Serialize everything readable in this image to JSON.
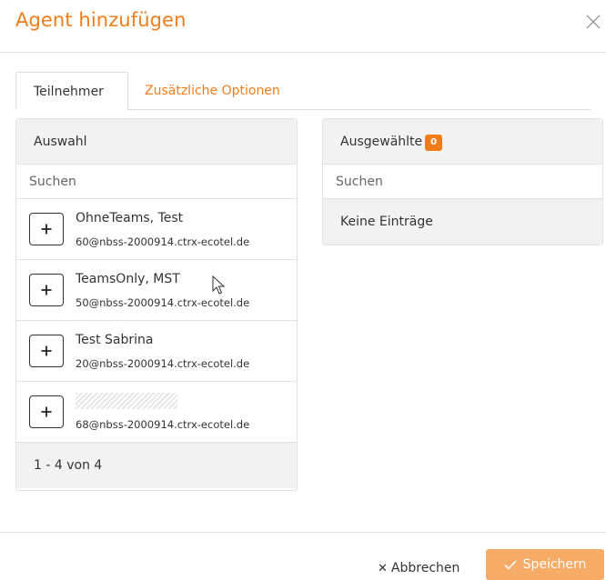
{
  "modal": {
    "title": "Agent hinzufügen",
    "close_icon": "close-icon"
  },
  "tabs": [
    {
      "label": "Teilnehmer",
      "active": true
    },
    {
      "label": "Zusätzliche Optionen",
      "active": false
    }
  ],
  "selection_panel": {
    "header": "Auswahl",
    "search_placeholder": "Suchen",
    "items": [
      {
        "name": "OhneTeams, Test",
        "email": "60@nbss-2000914.ctrx-ecotel.de",
        "name_redacted": false
      },
      {
        "name": "TeamsOnly, MST",
        "email": "50@nbss-2000914.ctrx-ecotel.de",
        "name_redacted": false
      },
      {
        "name": "Test Sabrina",
        "email": "20@nbss-2000914.ctrx-ecotel.de",
        "name_redacted": false
      },
      {
        "name": "",
        "email": "68@nbss-2000914.ctrx-ecotel.de",
        "name_redacted": true
      }
    ],
    "pagination": "1 - 4 von 4"
  },
  "selected_panel": {
    "header": "Ausgewählte",
    "count": "0",
    "search_placeholder": "Suchen",
    "empty_text": "Keine Einträge"
  },
  "footer": {
    "cancel_label": "Abbrechen",
    "save_label": "Speichern"
  },
  "colors": {
    "accent": "#f07d1a",
    "save_button": "#f6ab66",
    "panel_header_bg": "#f2f2f2",
    "border": "#e1e1e1"
  }
}
